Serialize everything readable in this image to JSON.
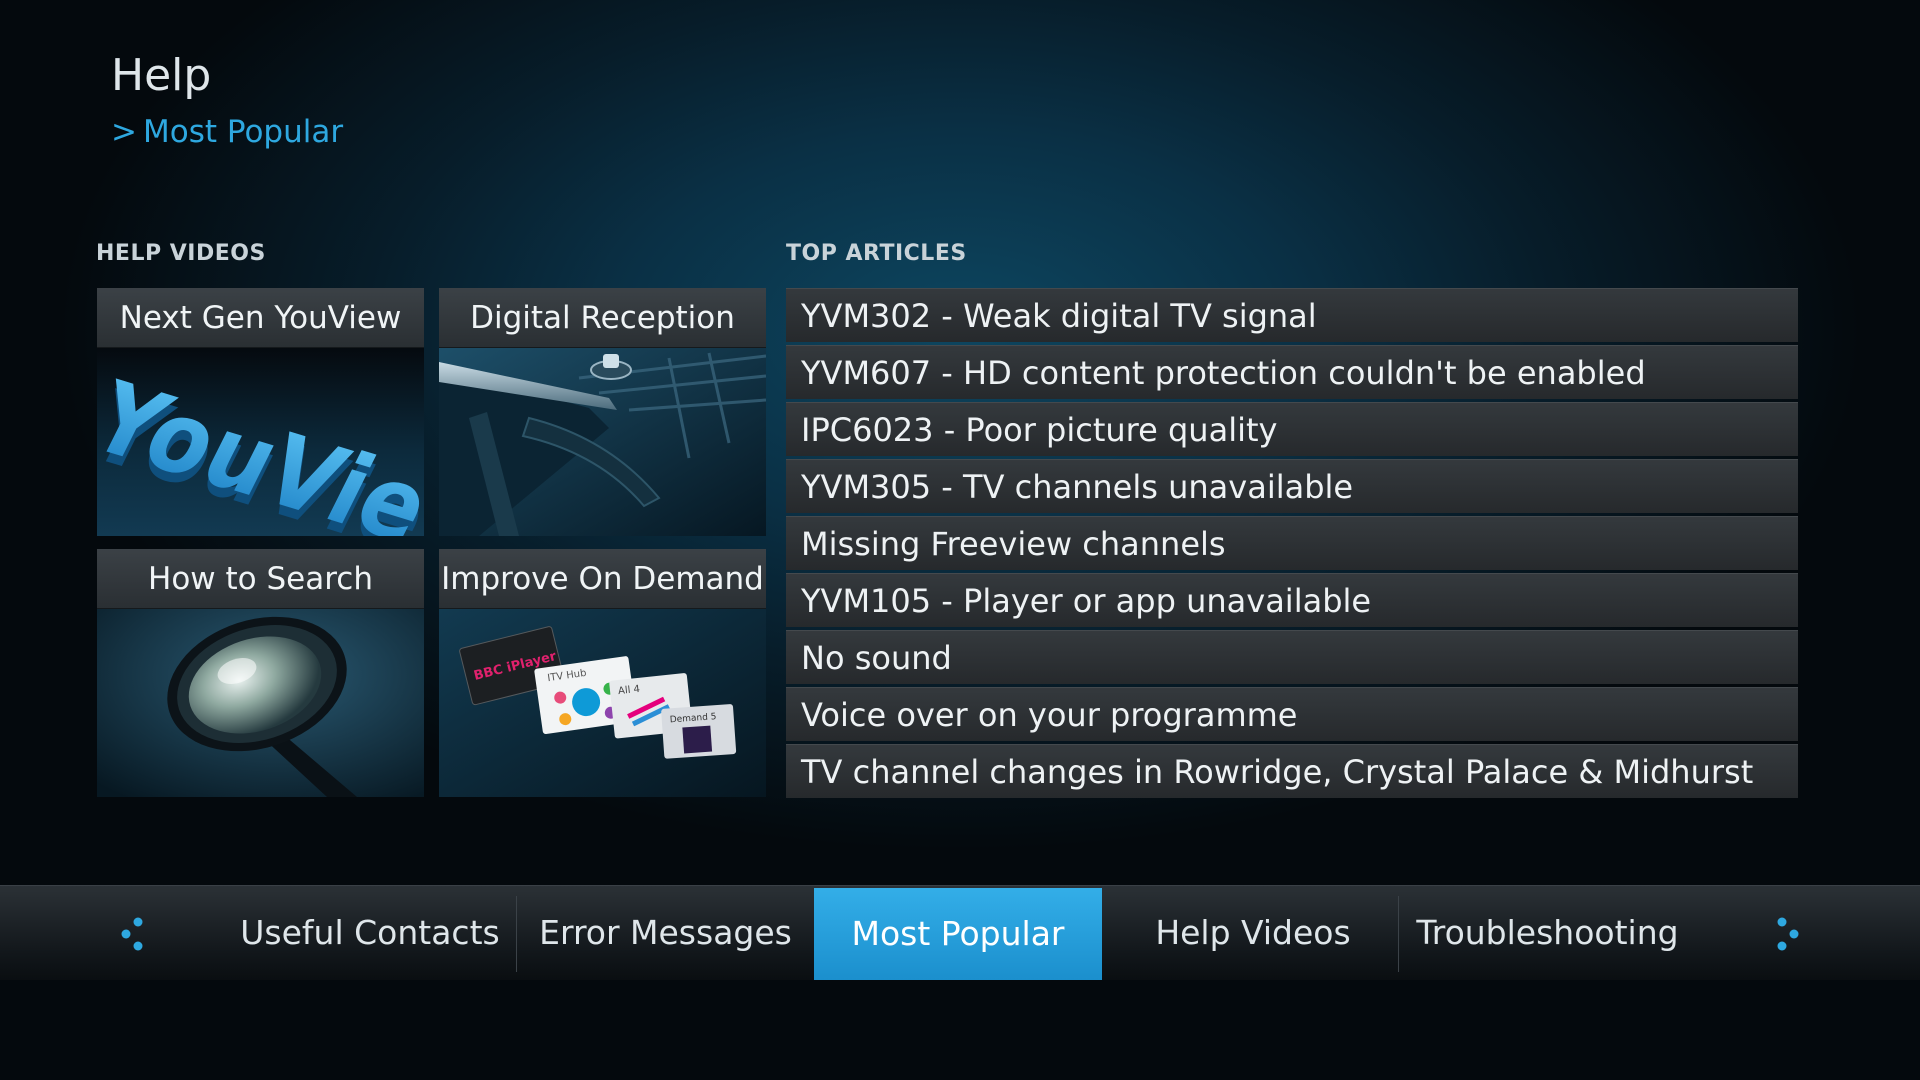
{
  "header": {
    "title": "Help",
    "breadcrumb_chevron": ">",
    "breadcrumb_label": "Most Popular"
  },
  "help_videos": {
    "label": "HELP VIDEOS",
    "tiles": [
      {
        "title": "Next Gen YouView",
        "art_text": "YouView"
      },
      {
        "title": "Digital Reception"
      },
      {
        "title": "How to Search"
      },
      {
        "title": "Improve On Demand",
        "art_cards": [
          "BBC iPlayer",
          "ITV Hub",
          "All 4",
          "Demand 5"
        ]
      }
    ]
  },
  "top_articles": {
    "label": "TOP ARTICLES",
    "items": [
      "YVM302 - Weak digital TV signal",
      "YVM607 - HD content protection couldn't be enabled",
      "IPC6023 - Poor picture quality",
      "YVM305 - TV channels unavailable",
      "Missing Freeview channels",
      "YVM105 - Player or app unavailable",
      "No sound",
      "Voice over on your programme",
      "TV channel changes in Rowridge, Crystal Palace & Midhurst"
    ]
  },
  "nav": {
    "tabs": [
      {
        "label": "Useful Contacts",
        "active": false
      },
      {
        "label": "Error Messages",
        "active": false
      },
      {
        "label": "Most Popular",
        "active": true
      },
      {
        "label": "Help Videos",
        "active": false
      },
      {
        "label": "Troubleshooting",
        "active": false
      }
    ],
    "left_arrow_icon": "nav-dots-left-icon",
    "right_arrow_icon": "nav-dots-right-icon"
  },
  "colors": {
    "accent": "#2ea8e0",
    "active_tab": "#1f9bd8",
    "tile_title_bg": "#33383c",
    "background": "#0a3045"
  }
}
